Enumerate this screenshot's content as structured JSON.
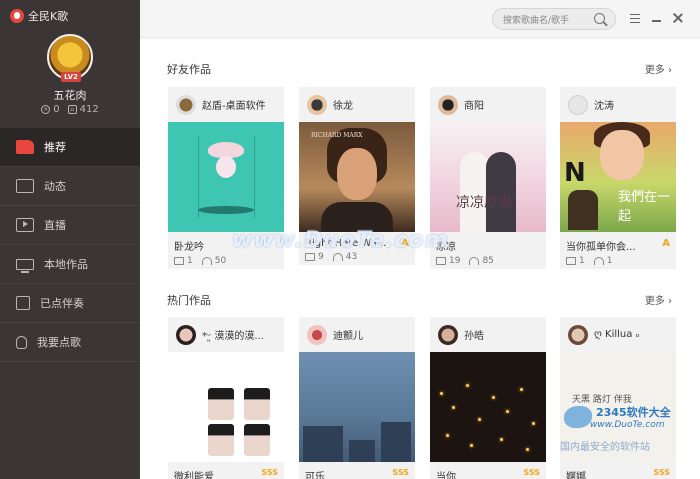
{
  "app": {
    "name": "全民K歌"
  },
  "profile": {
    "name": "五花肉",
    "level_badge": "LV2",
    "stat_a": "0",
    "stat_b": "412"
  },
  "nav": [
    {
      "label": "推荐",
      "icon": "thumbs-up-icon"
    },
    {
      "label": "动态",
      "icon": "chat-icon"
    },
    {
      "label": "直播",
      "icon": "video-icon"
    },
    {
      "label": "本地作品",
      "icon": "monitor-icon"
    },
    {
      "label": "已点伴奏",
      "icon": "document-icon"
    },
    {
      "label": "我要点歌",
      "icon": "microphone-icon"
    }
  ],
  "search": {
    "placeholder": "搜索歌曲名/歌手"
  },
  "friends_section": {
    "title": "好友作品",
    "more": "更多",
    "cards": [
      {
        "user": "赵盾-桌面软件",
        "title": "卧龙吟",
        "comments": "1",
        "listens": "50",
        "level": ""
      },
      {
        "user": "徐龙",
        "title": "Right Here Wa...",
        "comments": "9",
        "listens": "43",
        "level": "A"
      },
      {
        "user": "商阳",
        "title": "凉凉",
        "comments": "19",
        "listens": "85",
        "level": ""
      },
      {
        "user": "沈涛",
        "title": "当你孤单你会...",
        "comments": "1",
        "listens": "1",
        "level": "A"
      }
    ]
  },
  "hot_section": {
    "title": "热门作品",
    "more": "更多",
    "cards": [
      {
        "user": "*ᵕ͈ 漠漠的漠...",
        "title": "微利能爱",
        "level": "SSS"
      },
      {
        "user": "迪颤儿",
        "title": "可乐",
        "level": "SSS"
      },
      {
        "user": "孙皓",
        "title": "当你",
        "level": "SSS"
      },
      {
        "user": "ღ Killua ₒ",
        "title": "婀娜",
        "level": "SSS"
      }
    ]
  },
  "covers": {
    "richard_text": "RICHARD MARX",
    "drama_text": "凉凉原唱",
    "boy_letter": "N",
    "boy_text": "我們在一起",
    "paper_text": "天黑 路灯 伴我"
  },
  "watermark": {
    "site": "www.DuoTe.com"
  },
  "corner_watermark": {
    "line1": "2345软件大全",
    "line2": "www.DuoTe.com",
    "line3": "国内最安全的软件站"
  },
  "colors": {
    "sidebar": "#3b3535",
    "accent": "#e8473f",
    "level": "#f0a81c"
  }
}
